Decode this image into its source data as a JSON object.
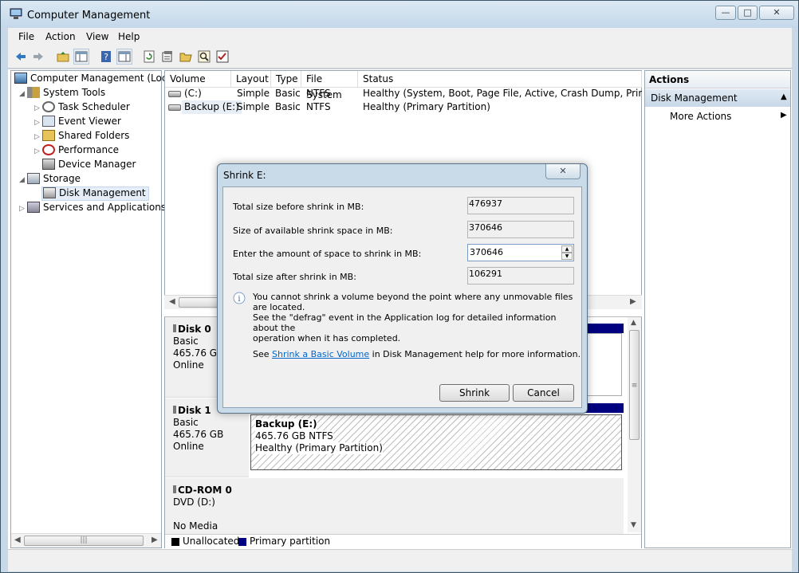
{
  "window": {
    "title": "Computer Management"
  },
  "menu": [
    "File",
    "Action",
    "View",
    "Help"
  ],
  "toolbar": {
    "icons": [
      "back-icon",
      "forward-icon",
      "up-folder-icon",
      "show-hide-console-tree-icon",
      "help-icon",
      "show-hide-action-pane-icon",
      "refresh-icon",
      "properties-icon",
      "open-folder-icon",
      "search-icon",
      "checklist-icon"
    ]
  },
  "tree": {
    "root": "Computer Management (Local",
    "system_tools": "System Tools",
    "task_scheduler": "Task Scheduler",
    "event_viewer": "Event Viewer",
    "shared_folders": "Shared Folders",
    "performance": "Performance",
    "device_manager": "Device Manager",
    "storage": "Storage",
    "disk_management": "Disk Management",
    "services": "Services and Applications"
  },
  "volumes": {
    "headers": [
      "Volume",
      "Layout",
      "Type",
      "File System",
      "Status"
    ],
    "rows": [
      {
        "volume": "(C:)",
        "layout": "Simple",
        "type": "Basic",
        "fs": "NTFS",
        "status": "Healthy (System, Boot, Page File, Active, Crash Dump, Primary Par"
      },
      {
        "volume": "Backup (E:)",
        "layout": "Simple",
        "type": "Basic",
        "fs": "NTFS",
        "status": "Healthy (Primary Partition)"
      }
    ]
  },
  "disks": {
    "disk0": {
      "name": "Disk 0",
      "type": "Basic",
      "size": "465.76 GB",
      "state": "Online"
    },
    "disk1": {
      "name": "Disk 1",
      "type": "Basic",
      "size": "465.76 GB",
      "state": "Online",
      "partition": {
        "name": "Backup  (E:)",
        "size": "465.76 GB NTFS",
        "status": "Healthy (Primary Partition)"
      }
    },
    "cdrom0": {
      "name": "CD-ROM 0",
      "drive": "DVD (D:)",
      "media": "No Media"
    }
  },
  "legend": {
    "unallocated": "Unallocated",
    "primary": "Primary partition",
    "unallocated_color": "#000000",
    "primary_color": "#000080"
  },
  "actions": {
    "header": "Actions",
    "section": "Disk Management",
    "more": "More Actions"
  },
  "dialog": {
    "title": "Shrink E:",
    "total_before_label": "Total size before shrink in MB:",
    "total_before_value": "476937",
    "available_label": "Size of available shrink space in MB:",
    "available_value": "370646",
    "amount_label": "Enter the amount of space to shrink in MB:",
    "amount_value": "370646",
    "after_label": "Total size after shrink in MB:",
    "after_value": "106291",
    "info_line1": "You cannot shrink a volume beyond the point where any unmovable files are located.",
    "info_line2": "See the \"defrag\" event in the Application log for detailed information about the",
    "info_line3": "operation when it has completed.",
    "see_prefix": "See ",
    "see_link": "Shrink a Basic Volume",
    "see_suffix": " in Disk Management help for more information.",
    "shrink_button": "Shrink",
    "cancel_button": "Cancel"
  }
}
